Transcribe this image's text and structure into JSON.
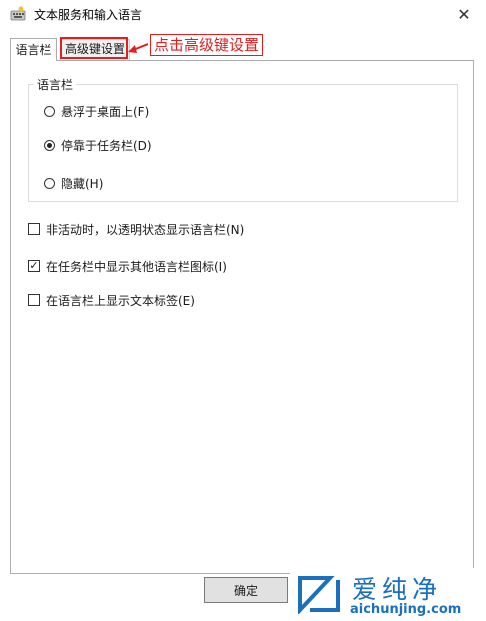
{
  "window": {
    "title": "文本服务和输入语言"
  },
  "tabs": {
    "language_bar": "语言栏",
    "advanced_keys": "高级键设置"
  },
  "annotation": {
    "text": "点击高级键设置"
  },
  "group": {
    "legend": "语言栏",
    "options": [
      {
        "label": "悬浮于桌面上(F)",
        "checked": false
      },
      {
        "label": "停靠于任务栏(D)",
        "checked": true
      },
      {
        "label": "隐藏(H)",
        "checked": false
      }
    ]
  },
  "checkboxes": [
    {
      "label": "非活动时，以透明状态显示语言栏(N)",
      "checked": false
    },
    {
      "label": "在任务栏中显示其他语言栏图标(I)",
      "checked": true
    },
    {
      "label": "在语言栏上显示文本标签(E)",
      "checked": false
    }
  ],
  "buttons": {
    "ok": "确定"
  },
  "watermark": {
    "cn": "爱纯净",
    "url": "aichunjing.com"
  },
  "colors": {
    "annotation": "#e02020",
    "watermark": "#1a6fbf"
  }
}
